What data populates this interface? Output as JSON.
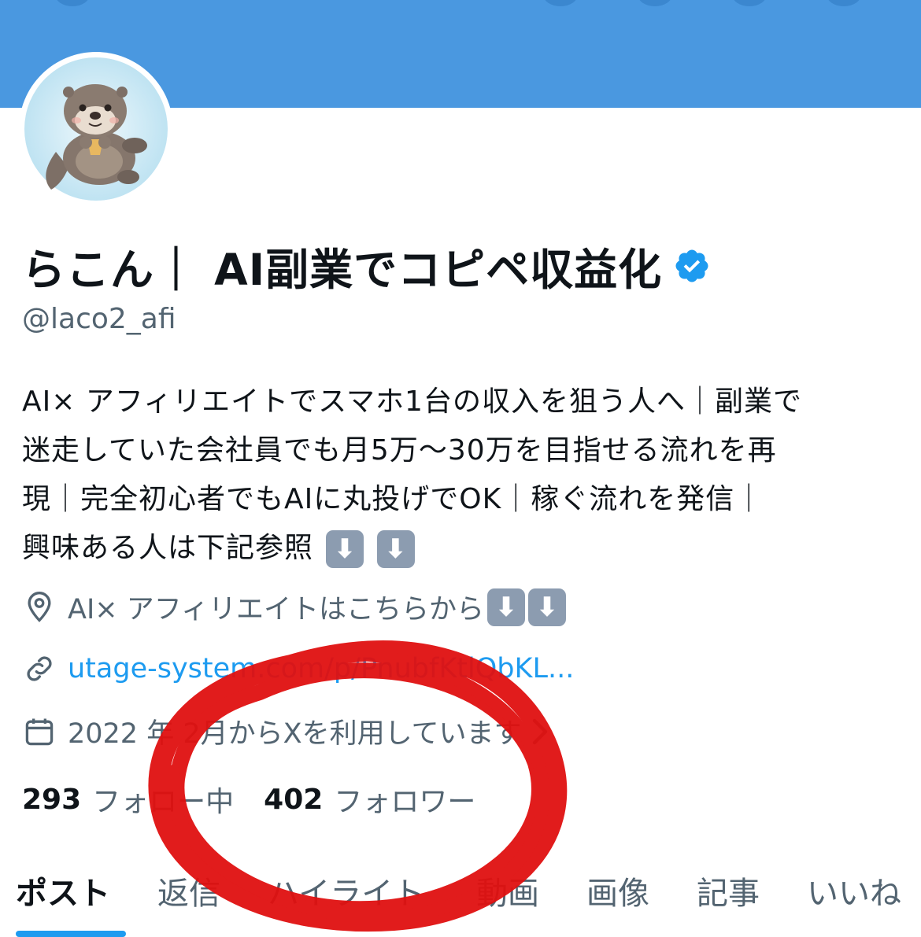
{
  "profile": {
    "display_name": "らこん｜ AI副業でコピペ収益化",
    "handle": "@laco2_afi",
    "bio_lines": [
      "AI× アフィリエイトでスマホ1台の収入を狙う人へ｜副業で",
      "迷走していた会社員でも月5万〜30万を目指せる流れを再",
      "現｜完全初心者でもAIに丸投げでOK｜稼ぐ流れを発信｜",
      "興味ある人は下記参照"
    ],
    "location": "AI× アフィリエイトはこちらから",
    "link": "utage-system.com/p/PnubfKtlQbKL...",
    "joined": "2022 年 2月からXを利用しています",
    "following_count": "293",
    "following_label": "フォロー中",
    "followers_count": "402",
    "followers_label": "フォロワー"
  },
  "tabs": [
    "ポスト",
    "返信",
    "ハイライト",
    "動画",
    "画像",
    "記事",
    "いいね"
  ],
  "active_tab": "ポスト",
  "emoji": {
    "down_arrow": "⬇"
  },
  "colors": {
    "banner": "#4a98e0",
    "accent": "#1d9bf0",
    "text": "#0f1419",
    "secondary": "#536471",
    "annotation": "#e01010"
  }
}
